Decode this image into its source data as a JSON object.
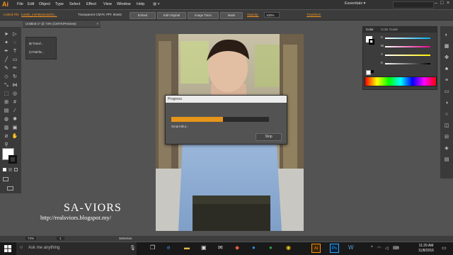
{
  "app": {
    "logo": "Ai"
  },
  "menu": [
    "File",
    "Edit",
    "Object",
    "Type",
    "Select",
    "Effect",
    "View",
    "Window",
    "Help"
  ],
  "workspace": {
    "label": "Essentials ▾"
  },
  "control_bar": {
    "linked_file": "Linked File",
    "file_name": "tumblr_meh8Ij4w3a2t1r...",
    "transparent": "Transparent CMYK",
    "ppi": "PPI: 60x62",
    "embed": "Embed",
    "edit_original": "Edit Original",
    "image_trace": "Image Trace",
    "mask": "Mask",
    "opacity_label": "Opacity:",
    "opacity_value": "100%",
    "transform": "Transform"
  },
  "document_tab": {
    "title": "Untitled-1* @ 74% (CMYK/Preview)",
    "close": "×"
  },
  "floating_panel": {
    "items": [
      "Transf...",
      "Pathfin..."
    ]
  },
  "color_panel": {
    "tabs": [
      "Color",
      "Color Guide"
    ],
    "sliders": [
      "C",
      "M",
      "Y",
      "K"
    ]
  },
  "progress": {
    "title": "Progress",
    "status": "Smart Blur...",
    "stop": "Stop",
    "fraction": 0.53
  },
  "status_bar": {
    "zoom": "74%",
    "page": "1",
    "tool": "Selection"
  },
  "watermark": {
    "line1": "SA-VIORS",
    "line2": "http://realsviors.blogspot.my/"
  },
  "taskbar": {
    "search_placeholder": "Ask me anything",
    "time": "11:29 AM",
    "date": "11/8/2016"
  },
  "colors": {
    "accent": "#f7941d",
    "progress": "#e69519",
    "panel": "#3c3c3c",
    "background": "#535353"
  }
}
